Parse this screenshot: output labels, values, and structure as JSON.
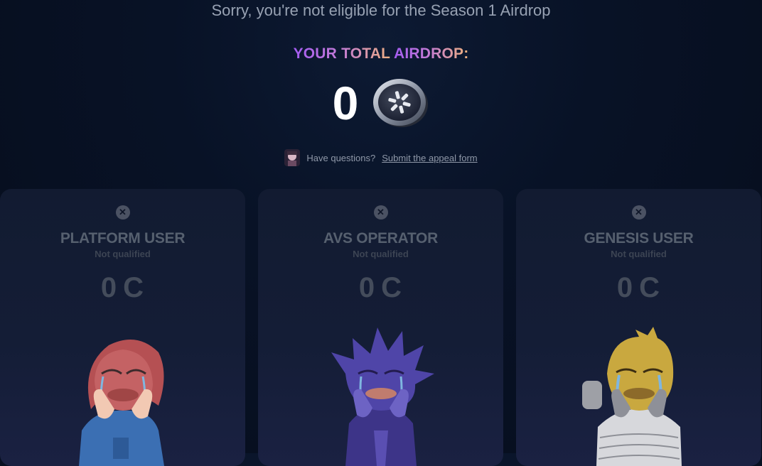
{
  "headline": "Sorry, you're not eligible for the Season 1 Airdrop",
  "total": {
    "label_prefix": "YOUR TOTAL ",
    "label_main": "AIRDROP:",
    "amount": "0",
    "coin_icon": "token-coin-icon"
  },
  "help": {
    "text": "Have questions?",
    "link": "Submit the appeal form"
  },
  "cards": [
    {
      "title": "PLATFORM USER",
      "status": "Not qualified",
      "points": "0",
      "unit": "C",
      "character_color": "#c4585b"
    },
    {
      "title": "AVS OPERATOR",
      "status": "Not qualified",
      "points": "0",
      "unit": "C",
      "character_color": "#4f45a8"
    },
    {
      "title": "GENESIS USER",
      "status": "Not qualified",
      "points": "0",
      "unit": "C",
      "character_color": "#c9a83f"
    }
  ],
  "colors": {
    "accent_gradient_start": "#a45cf2",
    "accent_gradient_end": "#f0b27c",
    "background": "#081226",
    "card": "#141d36"
  }
}
